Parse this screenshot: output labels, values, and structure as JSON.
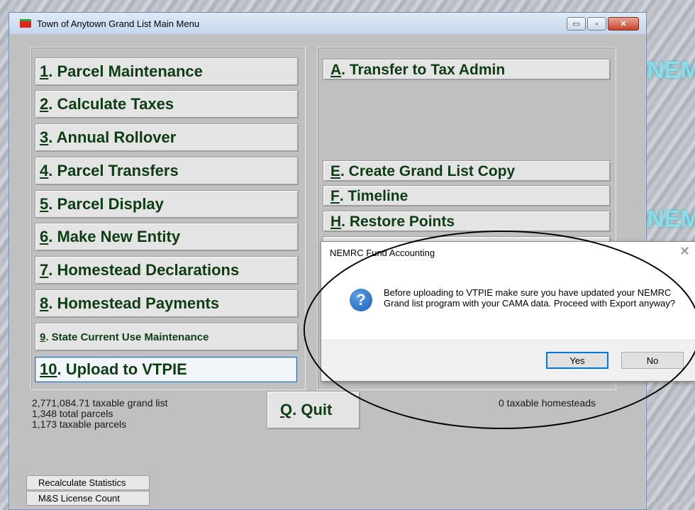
{
  "desktop": {
    "watermark": "NEM"
  },
  "window": {
    "title": "Town of Anytown Grand List Main Menu",
    "buttons": {
      "minimize": "▭",
      "maximize": "▫",
      "close": "✕"
    }
  },
  "left_menu": [
    {
      "key": "1",
      "label": ".  Parcel Maintenance"
    },
    {
      "key": "2",
      "label": ".  Calculate Taxes"
    },
    {
      "key": "3",
      "label": ".  Annual Rollover"
    },
    {
      "key": "4",
      "label": ".  Parcel Transfers"
    },
    {
      "key": "5",
      "label": ".  Parcel Display"
    },
    {
      "key": "6",
      "label": ". Make New Entity"
    },
    {
      "key": "7",
      "label": ". Homestead Declarations"
    },
    {
      "key": "8",
      "label": ". Homestead Payments"
    },
    {
      "key": "9",
      "label": ". State Current Use Maintenance"
    },
    {
      "key": "10",
      "label": ". Upload to VTPIE"
    }
  ],
  "right_menu": [
    {
      "key": "A",
      "label": ". Transfer to Tax Admin"
    },
    {
      "key": "E",
      "label": ". Create Grand List Copy"
    },
    {
      "key": "F",
      "label": ". Timeline"
    },
    {
      "key": "H",
      "label": ". Restore Points"
    }
  ],
  "stats": {
    "grand_list": "2,771,084.71 taxable grand list",
    "total_parcels": "1,348 total parcels",
    "taxable_parcels": "1,173 taxable parcels",
    "homesteads": "0 taxable homesteads"
  },
  "quit": {
    "key": "Q",
    "label": ".  Quit"
  },
  "bottom_buttons": {
    "recalc": "Recalculate Statistics",
    "license": "M&S License Count"
  },
  "dialog": {
    "title": "NEMRC Fund Accounting",
    "close": "✕",
    "icon": "question-icon",
    "icon_glyph": "?",
    "message": "Before uploading to VTPIE make sure you have updated your NEMRC Grand list program with your CAMA data.  Proceed with Export anyway?",
    "yes": "Yes",
    "no": "No"
  }
}
